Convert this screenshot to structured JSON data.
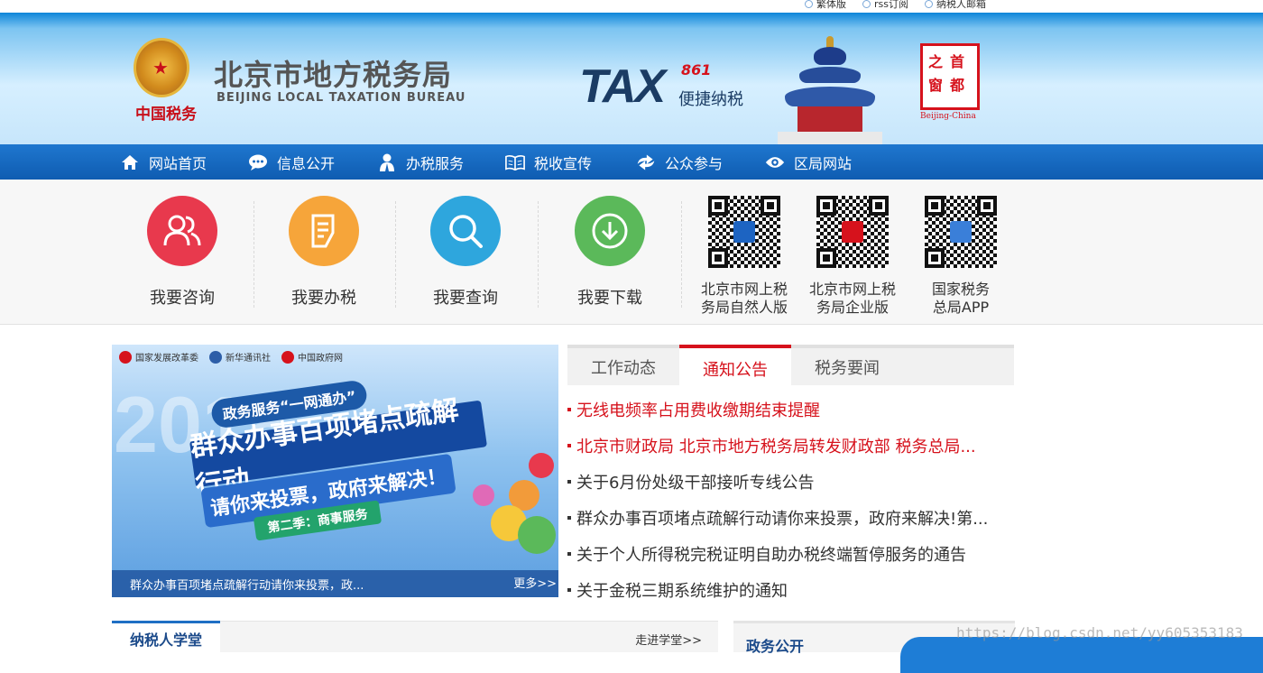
{
  "topbar": {
    "links": [
      {
        "label": "繁体版",
        "icon": "circle-arrow-icon"
      },
      {
        "label": "rss订阅",
        "icon": "circle-arrow-icon"
      },
      {
        "label": "纳税人邮箱",
        "icon": "circle-arrow-icon"
      }
    ]
  },
  "header": {
    "seal_text": "中国税务",
    "title_cn": "北京市地方税务局",
    "title_en": "BEIJING LOCAL TAXATION BUREAU",
    "tax_logo": "TAX",
    "tax_logo_num": "861",
    "tax_slogan": "便捷纳税",
    "capital_chars": [
      "首",
      "都",
      "之",
      "窗"
    ],
    "capital_en": "Beijing-China"
  },
  "nav": {
    "items": [
      {
        "label": "网站首页",
        "icon": "home-icon"
      },
      {
        "label": "信息公开",
        "icon": "chat-bubble-icon"
      },
      {
        "label": "办税服务",
        "icon": "person-icon"
      },
      {
        "label": "税收宣传",
        "icon": "book-icon"
      },
      {
        "label": "公众参与",
        "icon": "exchange-arrows-icon"
      },
      {
        "label": "区局网站",
        "icon": "eye-icon"
      }
    ]
  },
  "services": {
    "items": [
      {
        "label": "我要咨询",
        "icon": "people-icon",
        "color": "#e8394d"
      },
      {
        "label": "我要办税",
        "icon": "document-edit-icon",
        "color": "#f6a53a"
      },
      {
        "label": "我要查询",
        "icon": "search-icon",
        "color": "#2ea6dd"
      },
      {
        "label": "我要下载",
        "icon": "download-icon",
        "color": "#5bb95a"
      }
    ],
    "qrcodes": [
      {
        "label_line1": "北京市网上税",
        "label_line2": "务局自然人版",
        "center_color": "#1d64c2"
      },
      {
        "label_line1": "北京市网上税",
        "label_line2": "务局企业版",
        "center_color": "#d6121c"
      },
      {
        "label_line1": "国家税务",
        "label_line2": "总局APP",
        "center_color": "#3a7fd9"
      }
    ]
  },
  "banner": {
    "logos": [
      "国家发展改革委",
      "新华通讯社",
      "中国政府网"
    ],
    "year": "2018",
    "tag": "政务服务“一网通办”",
    "headline": "群众办事百项堵点疏解行动",
    "subline": "请你来投票，政府来解决！",
    "season": "第二季：商事服务",
    "caption": "群众办事百项堵点疏解行动请你来投票，政...",
    "more": "更多>>"
  },
  "news": {
    "tabs": [
      {
        "label": "工作动态",
        "active": false
      },
      {
        "label": "通知公告",
        "active": true
      },
      {
        "label": "税务要闻",
        "active": false
      }
    ],
    "items": [
      {
        "text": "无线电频率占用费收缴期结束提醒",
        "highlight": true
      },
      {
        "text": "北京市财政局 北京市地方税务局转发财政部 税务总局...",
        "highlight": true
      },
      {
        "text": "关于6月份处级干部接听专线公告",
        "highlight": false
      },
      {
        "text": "群众办事百项堵点疏解行动请你来投票，政府来解决!第...",
        "highlight": false
      },
      {
        "text": "关于个人所得税完税证明自助办税终端暂停服务的通告",
        "highlight": false
      },
      {
        "text": "关于金税三期系统维护的通知",
        "highlight": false
      }
    ]
  },
  "bottom": {
    "left_title": "纳税人学堂",
    "left_more": "走进学堂>>",
    "right_title": "政务公开"
  },
  "watermark": "https://blog.csdn.net/yy605353183",
  "colors": {
    "brand_blue": "#1f77cf",
    "accent_red": "#d6121c"
  }
}
